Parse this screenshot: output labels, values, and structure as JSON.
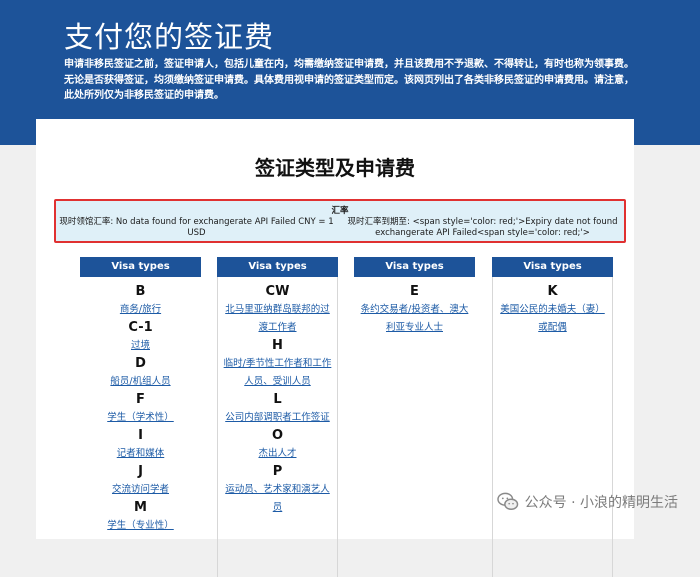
{
  "hero": {
    "title": "支付您的签证费",
    "description": "申请非移民签证之前，签证申请人，包括儿童在内，均需缴纳签证申请费，并且该费用不予退款、不得转让，有时也称为领事费。无论是否获得签证，均须缴纳签证申请费。具体费用视申请的签证类型而定。该网页列出了各类非移民签证的申请费用。请注意，此处所列仅为非移民签证的申请费。"
  },
  "card": {
    "title": "签证类型及申请费"
  },
  "exchange_rate": {
    "title": "汇率",
    "consular_label": "现时领馆汇率: No data found for exchangerate API Failed CNY = 1 USD",
    "expiry_label": "现时汇率到期至: <span style='color: red;'>Expiry date not found exchangerate API Failed<span style='color: red;'>"
  },
  "columns": [
    {
      "header": "Visa types",
      "groups": [
        {
          "letter": "B",
          "links": [
            "商务/旅行"
          ]
        },
        {
          "letter": "C-1",
          "links": [
            "过境"
          ]
        },
        {
          "letter": "D",
          "links": [
            "船员/机组人员"
          ]
        },
        {
          "letter": "F",
          "links": [
            "学生（学术性）"
          ]
        },
        {
          "letter": "I",
          "links": [
            "记者和媒体"
          ]
        },
        {
          "letter": "J",
          "links": [
            "交流访问学者"
          ]
        },
        {
          "letter": "M",
          "links": [
            "学生（专业性）"
          ]
        }
      ]
    },
    {
      "header": "Visa types",
      "groups": [
        {
          "letter": "CW",
          "links": [
            "北马里亚纳群岛联邦的过渡工作者"
          ]
        },
        {
          "letter": "H",
          "links": [
            "临时/季节性工作者和工作人员、受训人员"
          ]
        },
        {
          "letter": "L",
          "links": [
            "公司内部调职者工作签证"
          ]
        },
        {
          "letter": "O",
          "links": [
            "杰出人才"
          ]
        },
        {
          "letter": "P",
          "links": [
            "运动员、艺术家和演艺人员"
          ]
        }
      ]
    },
    {
      "header": "Visa types",
      "groups": [
        {
          "letter": "E",
          "links": [
            "条约交易者/投资者、澳大利亚专业人士"
          ]
        }
      ]
    },
    {
      "header": "Visa types",
      "groups": [
        {
          "letter": "K",
          "links": [
            "美国公民的未婚夫（妻）或配偶"
          ]
        }
      ]
    }
  ],
  "watermark": {
    "text": "公众号 · 小浪的精明生活",
    "icon": "wechat-icon"
  },
  "colors": {
    "brand_blue": "#1d5399",
    "link_blue": "#1d5ba6",
    "rate_bg": "#dff0f8",
    "highlight_red": "#e03131"
  }
}
